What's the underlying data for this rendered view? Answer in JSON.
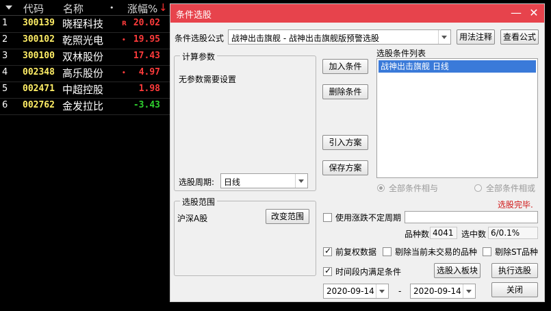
{
  "stock_list": {
    "headers": {
      "code": "代码",
      "name": "名称",
      "dot": "•",
      "change": "涨幅%",
      "sort_arrow": "↓"
    },
    "rows": [
      {
        "idx": "1",
        "code": "300139",
        "name": "晓程科技",
        "tag": "R",
        "change": "20.02",
        "dir": "up"
      },
      {
        "idx": "2",
        "code": "300102",
        "name": "乾照光电",
        "tag": "•",
        "change": "19.95",
        "dir": "up"
      },
      {
        "idx": "3",
        "code": "300100",
        "name": "双林股份",
        "tag": "",
        "change": "17.43",
        "dir": "up"
      },
      {
        "idx": "4",
        "code": "002348",
        "name": "高乐股份",
        "tag": "•",
        "change": "4.97",
        "dir": "up"
      },
      {
        "idx": "5",
        "code": "002471",
        "name": "中超控股",
        "tag": "",
        "change": "1.98",
        "dir": "up"
      },
      {
        "idx": "6",
        "code": "002762",
        "name": "金发拉比",
        "tag": "",
        "change": "-3.43",
        "dir": "down"
      }
    ]
  },
  "dialog": {
    "title": "条件选股",
    "formula_label": "条件选股公式",
    "formula_value": "战神出击旗舰 - 战神出击旗舰版预警选股",
    "usage_button": "用法注释",
    "view_formula_button": "查看公式",
    "params_group": "计算参数",
    "params_text": "无参数需要设置",
    "period_label": "选股周期:",
    "period_value": "日线",
    "add_condition": "加入条件",
    "delete_condition": "删除条件",
    "import_plan": "引入方案",
    "save_plan": "保存方案",
    "condition_list_label": "选股条件列表",
    "condition_items": [
      "战神出击旗舰  日线"
    ],
    "radio_and": "全部条件相与",
    "radio_or": "全部条件相或",
    "status_text": "选股完毕.",
    "scope_group": "选股范围",
    "scope_value": "沪深A股",
    "change_scope": "改变范围",
    "use_period_label": "使用涨跌不定周期",
    "count_label": "品种数",
    "count_value": "4041",
    "selected_label": "选中数",
    "selected_value": "6/0.1%",
    "adj_label": "前复权数据",
    "exclude_untraded": "剔除当前未交易的品种",
    "exclude_st": "剔除ST品种",
    "time_range_label": "时间段内满足条件",
    "to_block_button": "选股入板块",
    "execute_button": "执行选股",
    "date_from": "2020-09-14",
    "date_sep": "-",
    "date_to": "2020-09-14",
    "close_button": "关闭",
    "minimize_glyph": "—",
    "close_glyph": "✕"
  }
}
